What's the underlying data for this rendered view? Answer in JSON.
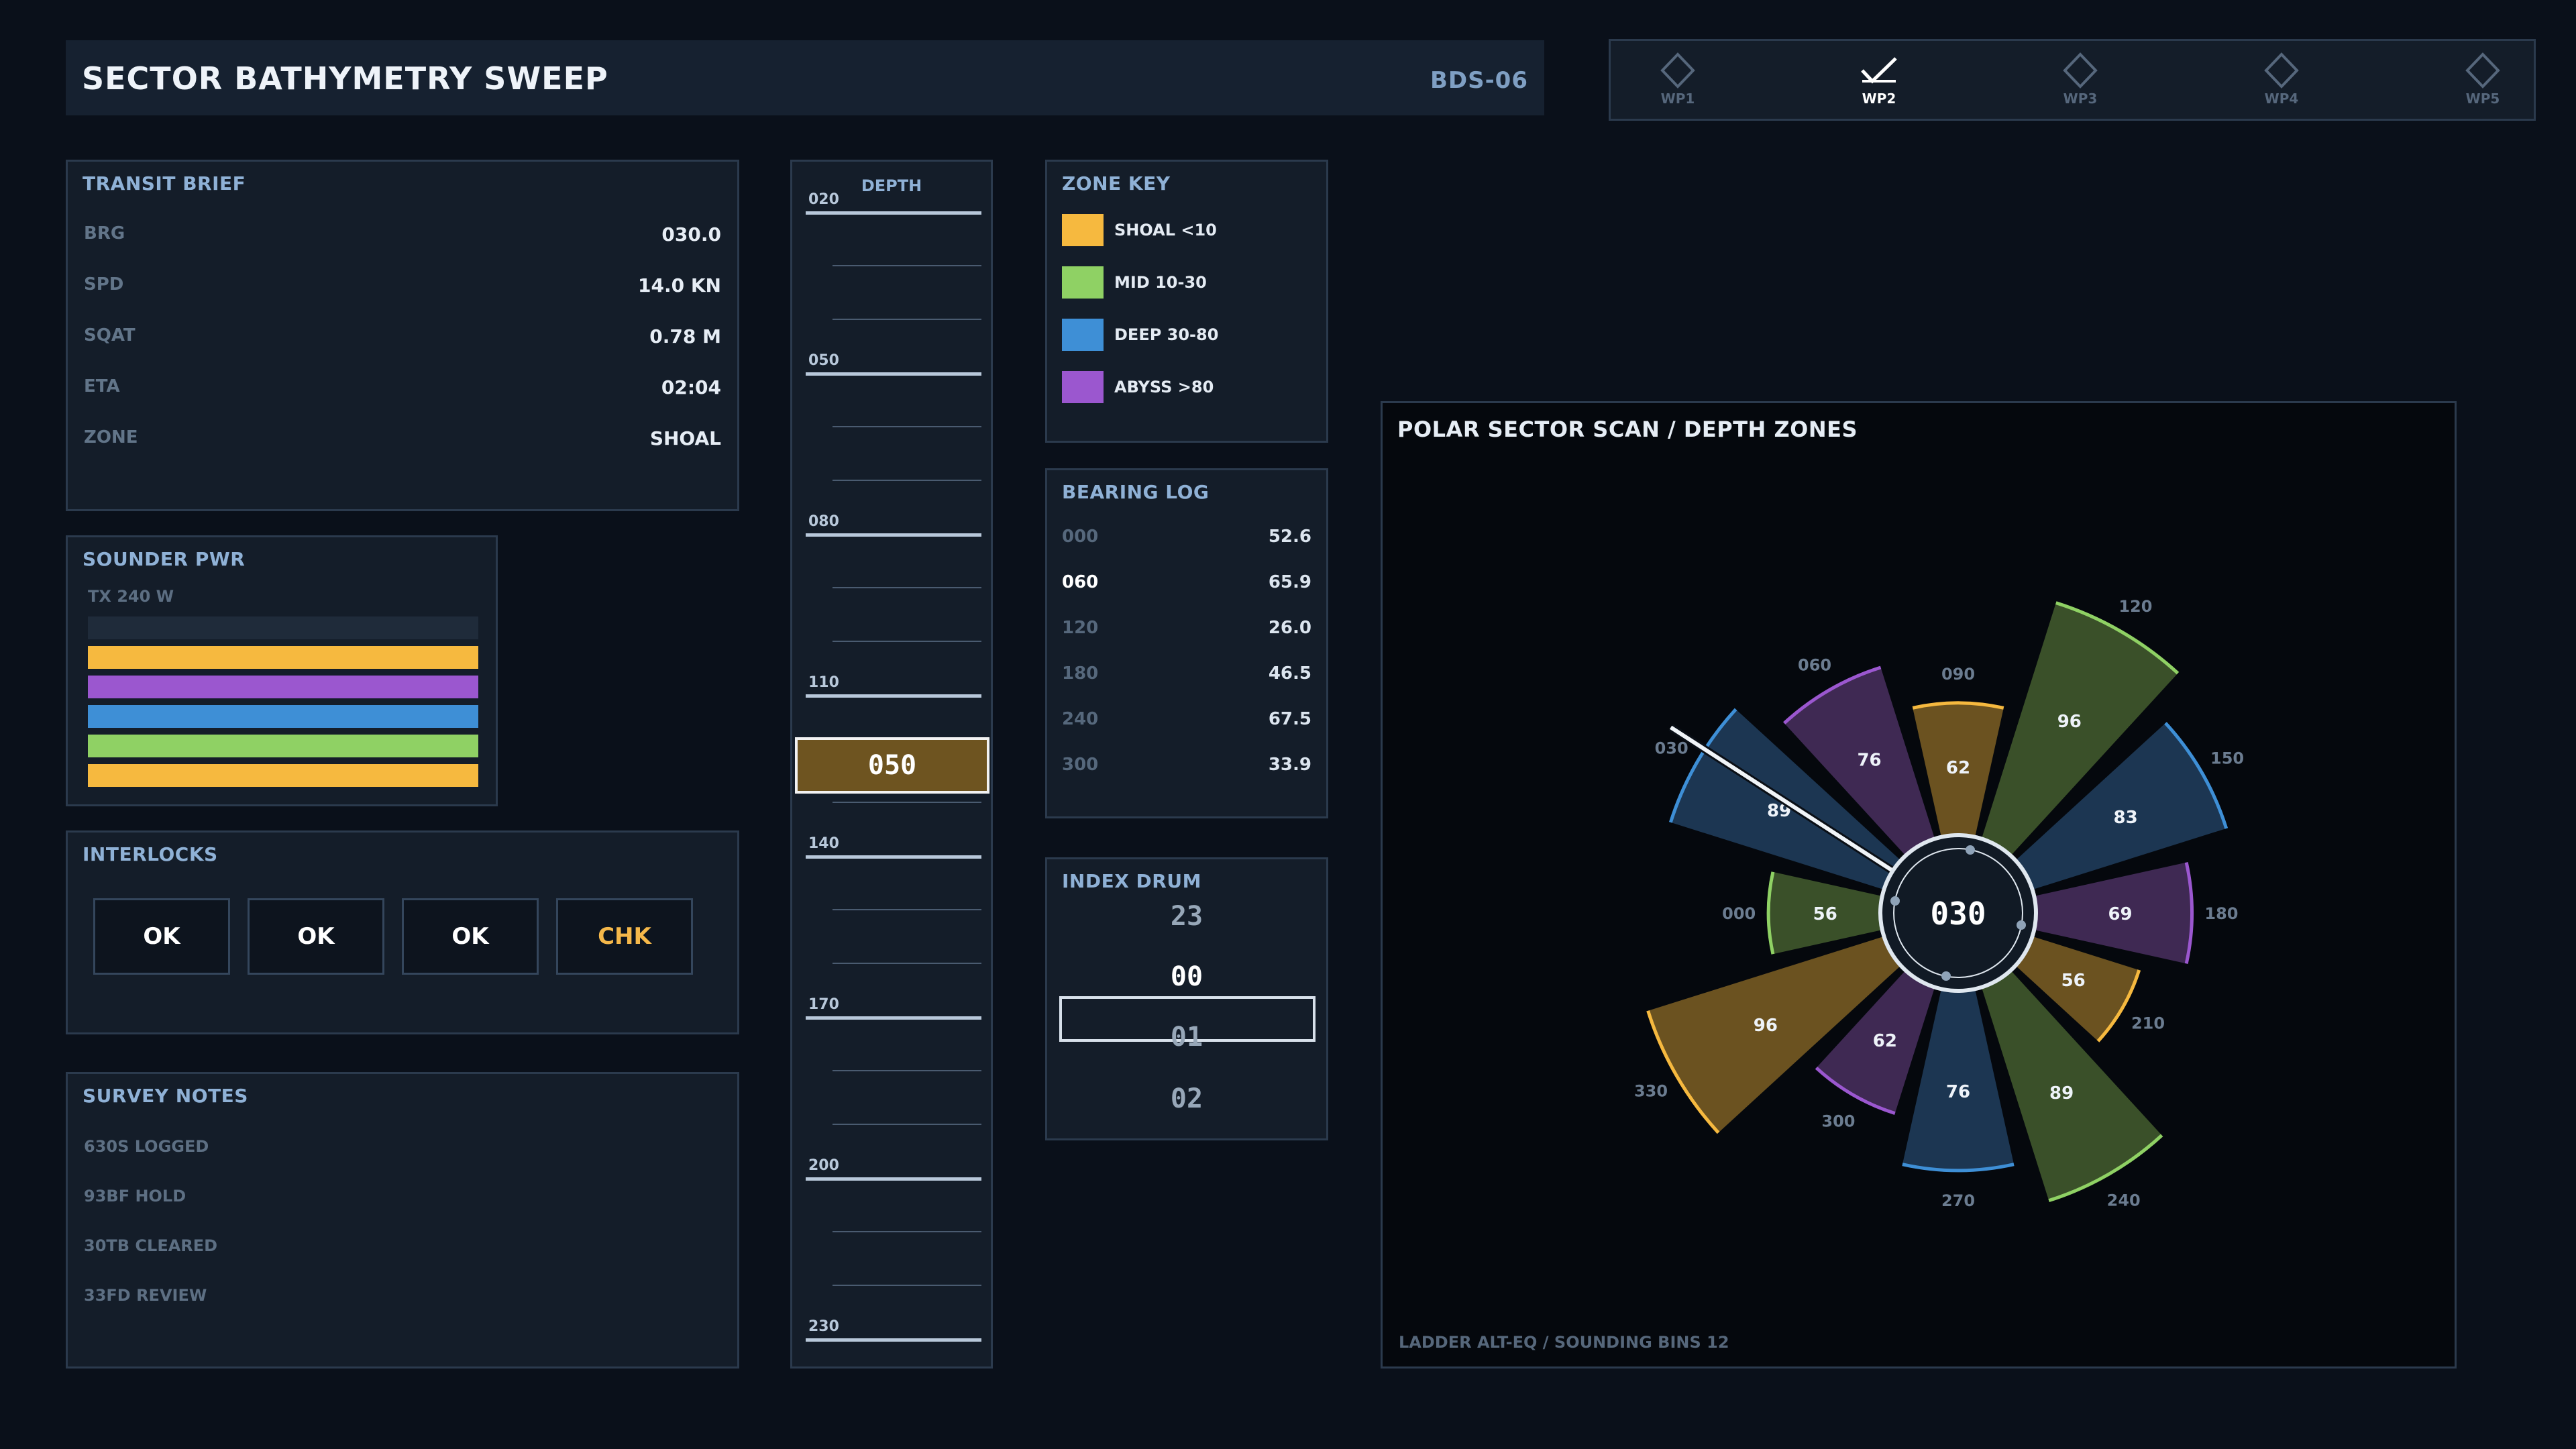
{
  "header": {
    "title": "SECTOR BATHYMETRY SWEEP",
    "code": "BDS-06"
  },
  "waypoints": [
    {
      "label": "WP1",
      "active": false
    },
    {
      "label": "WP2",
      "active": true
    },
    {
      "label": "WP3",
      "active": false
    },
    {
      "label": "WP4",
      "active": false
    },
    {
      "label": "WP5",
      "active": false
    }
  ],
  "transit": {
    "title": "TRANSIT BRIEF",
    "rows": [
      {
        "k": "BRG",
        "v": "030.0"
      },
      {
        "k": "SPD",
        "v": "14.0 KN"
      },
      {
        "k": "SQAT",
        "v": "0.78 M"
      },
      {
        "k": "ETA",
        "v": "02:04"
      },
      {
        "k": "ZONE",
        "v": "SHOAL"
      }
    ]
  },
  "sounder": {
    "title": "SOUNDER PWR",
    "sub": "TX 240 W",
    "bars": [
      "#1f2b3a",
      "#f6b93f",
      "#9b57cf",
      "#3e8fd6",
      "#8fd164",
      "#f6b93f"
    ]
  },
  "interlocks": {
    "title": "INTERLOCKS",
    "items": [
      {
        "label": "OK",
        "warn": false
      },
      {
        "label": "OK",
        "warn": false
      },
      {
        "label": "OK",
        "warn": false
      },
      {
        "label": "CHK",
        "warn": true
      }
    ]
  },
  "notes": {
    "title": "SURVEY NOTES",
    "items": [
      "630S LOGGED",
      "93BF HOLD",
      "30TB CLEARED",
      "33FD REVIEW"
    ]
  },
  "ladder": {
    "header": "DEPTH",
    "labels": [
      "020",
      "050",
      "080",
      "110",
      "140",
      "170",
      "200",
      "230"
    ],
    "cursor": "050"
  },
  "zonekey": {
    "title": "ZONE KEY",
    "items": [
      {
        "label": "SHOAL <10",
        "color": "#f6b93f"
      },
      {
        "label": "MID 10-30",
        "color": "#8fd164"
      },
      {
        "label": "DEEP 30-80",
        "color": "#3e8fd6"
      },
      {
        "label": "ABYSS >80",
        "color": "#9b57cf"
      }
    ]
  },
  "bearing": {
    "title": "BEARING LOG",
    "rows": [
      {
        "k": "000",
        "v": "52.6",
        "active": false
      },
      {
        "k": "060",
        "v": "65.9",
        "active": true
      },
      {
        "k": "120",
        "v": "26.0",
        "active": false
      },
      {
        "k": "180",
        "v": "46.5",
        "active": false
      },
      {
        "k": "240",
        "v": "67.5",
        "active": false
      },
      {
        "k": "300",
        "v": "33.9",
        "active": false
      }
    ]
  },
  "drum": {
    "title": "INDEX DRUM",
    "values": [
      "23",
      "00",
      "01",
      "02"
    ],
    "selected": "00"
  },
  "polar": {
    "title": "POLAR SECTOR SCAN / DEPTH ZONES",
    "footer": "LADDER ALT-EQ / SOUNDING BINS 12",
    "center_label": "030",
    "needle_bearing": 30,
    "sectors": [
      {
        "bearing": "000",
        "value": 56,
        "zone": "mid"
      },
      {
        "bearing": "030",
        "value": 89,
        "zone": "deep"
      },
      {
        "bearing": "060",
        "value": 76,
        "zone": "abyss"
      },
      {
        "bearing": "090",
        "value": 62,
        "zone": "shoal"
      },
      {
        "bearing": "120",
        "value": 96,
        "zone": "mid"
      },
      {
        "bearing": "150",
        "value": 83,
        "zone": "deep"
      },
      {
        "bearing": "180",
        "value": 69,
        "zone": "abyss"
      },
      {
        "bearing": "210",
        "value": 56,
        "zone": "shoal"
      },
      {
        "bearing": "240",
        "value": 89,
        "zone": "mid"
      },
      {
        "bearing": "270",
        "value": 76,
        "zone": "deep"
      },
      {
        "bearing": "300",
        "value": 62,
        "zone": "abyss"
      },
      {
        "bearing": "330",
        "value": 96,
        "zone": "shoal"
      }
    ],
    "zone_colors": {
      "shoal": {
        "fill": "#6b5220",
        "edge": "#f6b93f"
      },
      "mid": {
        "fill": "#3a5029",
        "edge": "#8fd164"
      },
      "deep": {
        "fill": "#1c3652",
        "edge": "#3e8fd6"
      },
      "abyss": {
        "fill": "#3f2953",
        "edge": "#9b57cf"
      }
    }
  }
}
